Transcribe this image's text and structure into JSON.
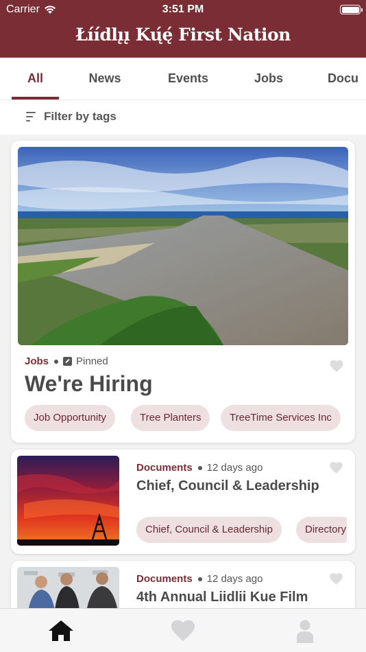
{
  "status_bar": {
    "carrier": "Carrier",
    "time": "3:51 PM"
  },
  "header": {
    "title": "Łı́ı́dlı̨ı̨ Kų́ę́ First Nation"
  },
  "tabs": [
    {
      "label": "All",
      "active": true
    },
    {
      "label": "News"
    },
    {
      "label": "Events"
    },
    {
      "label": "Jobs"
    },
    {
      "label": "Docu"
    }
  ],
  "filter": {
    "label": "Filter by tags"
  },
  "posts": [
    {
      "category": "Jobs",
      "aux": "Pinned",
      "title": "We're Hiring",
      "tags": [
        "Job Opportunity",
        "Tree Planters",
        "TreeTime Services Inc"
      ]
    },
    {
      "category": "Documents",
      "aux": "12 days ago",
      "title": "Chief, Council & Leadership",
      "tags": [
        "Chief, Council & Leadership",
        "Directory"
      ]
    },
    {
      "category": "Documents",
      "aux": "12 days ago",
      "title": "4th Annual Liidlii Kue Film"
    }
  ],
  "bottom_nav": {
    "icons": [
      "home-icon",
      "heart-icon",
      "person-icon"
    ],
    "active": "home-icon"
  },
  "colors": {
    "brand": "#7b2d35",
    "chip_bg": "#eee0e1",
    "page_bg": "#f2f2f3"
  }
}
